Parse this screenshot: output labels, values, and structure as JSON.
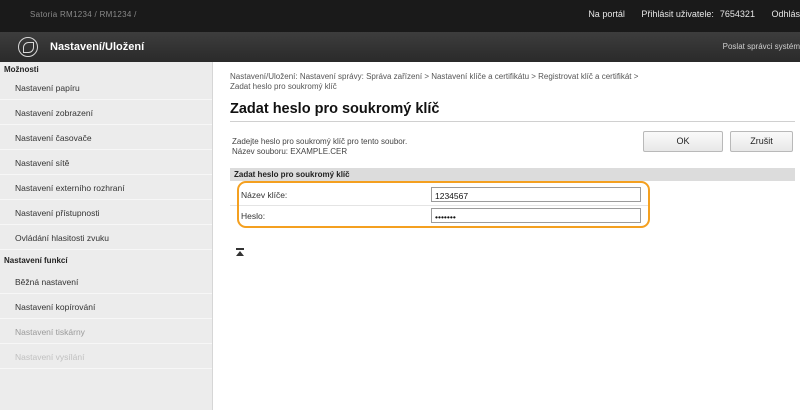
{
  "topbar": {
    "device_name": "Satoria   RM1234 / RM1234 /",
    "portal": "Na portál",
    "login_label": "Přihlásit uživatele:",
    "user_id": "7654321",
    "logout": "Odhlás"
  },
  "titlebar": {
    "app_title": "Nastavení/Uložení",
    "mail_admin": "Poslat správci systém"
  },
  "sidebar": {
    "options_header": "Možnosti",
    "items": [
      {
        "label": "Nastavení papíru"
      },
      {
        "label": "Nastavení zobrazení"
      },
      {
        "label": "Nastavení časovače"
      },
      {
        "label": "Nastavení sítě"
      },
      {
        "label": "Nastavení externího rozhraní"
      },
      {
        "label": "Nastavení přístupnosti"
      },
      {
        "label": "Ovládání hlasitosti zvuku"
      }
    ],
    "functions_header": "Nastavení funkcí",
    "function_items": [
      {
        "label": "Běžná nastavení"
      },
      {
        "label": "Nastavení kopírování"
      },
      {
        "label": "Nastavení tiskárny"
      },
      {
        "label": "Nastavení vysílání"
      }
    ]
  },
  "main": {
    "breadcrumb_line1": "Nastavení/Uložení: Nastavení správy: Správa zařízení > Nastavení klíče a certifikátu > Registrovat klíč a certifikát >",
    "breadcrumb_line2": "Zadat heslo pro soukromý klíč",
    "title": "Zadat heslo pro soukromý klíč",
    "desc_line1": "Zadejte heslo pro soukromý klíč pro tento soubor.",
    "desc_line2": "Název souboru: EXAMPLE.CER",
    "ok_label": "OK",
    "cancel_label": "Zrušit",
    "section_title": "Zadat heslo pro soukromý klíč",
    "key_name_label": "Název klíče:",
    "key_name_value": "1234567",
    "password_label": "Heslo:",
    "password_value": "•••••••"
  },
  "colors": {
    "highlight": "#f4a020",
    "topbar": "#1a1a1a",
    "sidebar_bg": "#ececec"
  }
}
